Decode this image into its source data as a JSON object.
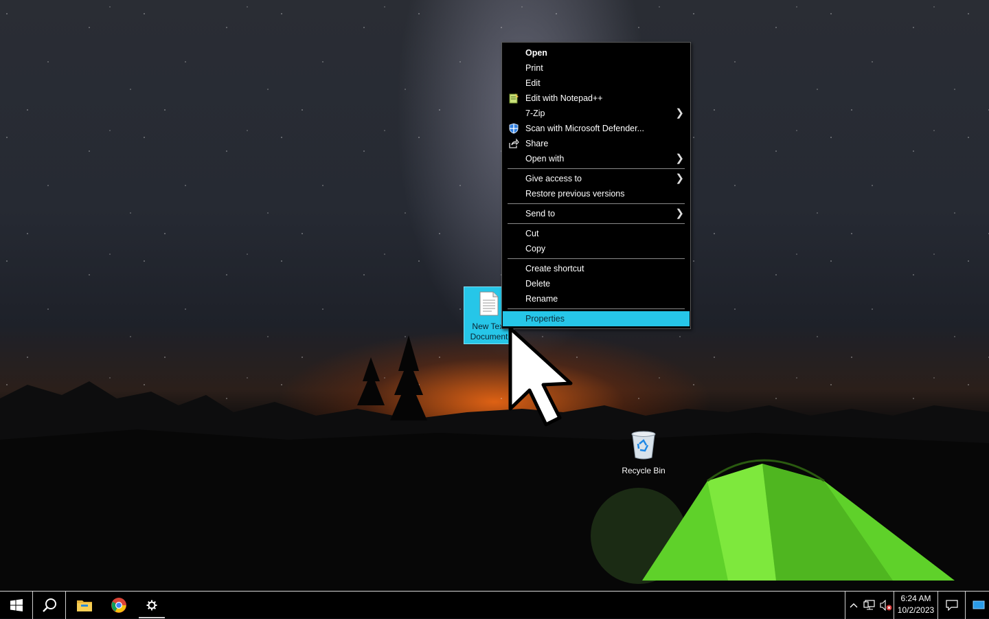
{
  "desktop": {
    "icons": [
      {
        "label": "New Text Document"
      },
      {
        "label": "Recycle Bin"
      }
    ],
    "file_icon_label_line1": "New Text",
    "file_icon_label_line2": "Document"
  },
  "context_menu": {
    "items": [
      {
        "label": "Open",
        "icon": ""
      },
      {
        "label": "Print",
        "icon": ""
      },
      {
        "label": "Edit",
        "icon": ""
      },
      {
        "label": "Edit with Notepad++",
        "icon": "notepadpp-icon"
      },
      {
        "label": "7-Zip",
        "icon": "",
        "submenu": true
      },
      {
        "label": "Scan with Microsoft Defender...",
        "icon": "defender-shield-icon"
      },
      {
        "label": "Share",
        "icon": "share-icon"
      },
      {
        "label": "Open with",
        "icon": "",
        "submenu": true
      },
      {
        "label": "Give access to",
        "icon": "",
        "submenu": true
      },
      {
        "label": "Restore previous versions",
        "icon": ""
      },
      {
        "label": "Send to",
        "icon": "",
        "submenu": true
      },
      {
        "label": "Cut",
        "icon": ""
      },
      {
        "label": "Copy",
        "icon": ""
      },
      {
        "label": "Create shortcut",
        "icon": ""
      },
      {
        "label": "Delete",
        "icon": ""
      },
      {
        "label": "Rename",
        "icon": ""
      },
      {
        "label": "Properties",
        "icon": "",
        "selected": true
      }
    ],
    "highlight_color": "#26c6e8"
  },
  "taskbar": {
    "pinned": [
      "start-icon",
      "search-icon",
      "file-explorer-icon",
      "chrome-icon",
      "settings-gear-icon"
    ],
    "clock": {
      "time": "6:24 AM",
      "date": "10/2/2023"
    },
    "tray": [
      "show-hidden-icons-chevron",
      "network-icon",
      "volume-muted-icon",
      "notification-icon",
      "show-desktop"
    ]
  }
}
